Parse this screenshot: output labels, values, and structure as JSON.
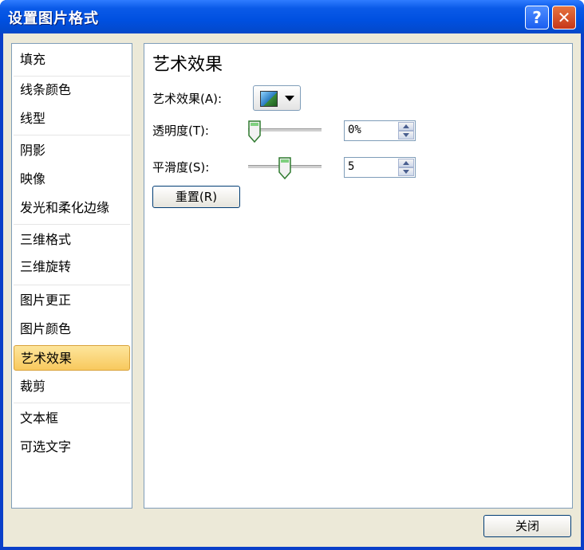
{
  "window": {
    "title": "设置图片格式",
    "help_label": "?",
    "close_label": "✕"
  },
  "nav": {
    "items": [
      {
        "label": "填充"
      },
      {
        "label": "线条颜色"
      },
      {
        "label": "线型"
      },
      {
        "label": "阴影"
      },
      {
        "label": "映像"
      },
      {
        "label": "发光和柔化边缘"
      },
      {
        "label": "三维格式"
      },
      {
        "label": "三维旋转"
      },
      {
        "label": "图片更正"
      },
      {
        "label": "图片颜色"
      },
      {
        "label": "艺术效果"
      },
      {
        "label": "裁剪"
      },
      {
        "label": "文本框"
      },
      {
        "label": "可选文字"
      }
    ],
    "selected": "艺术效果"
  },
  "panel": {
    "heading": "艺术效果",
    "effect_label": "艺术效果(A):",
    "transparency_label": "透明度(T):",
    "transparency_value": "0%",
    "transparency_level": 0,
    "smoothness_label": "平滑度(S):",
    "smoothness_value": "5",
    "smoothness_level": 0.5,
    "reset_label": "重置(R)"
  },
  "footer": {
    "close_label": "关闭"
  }
}
